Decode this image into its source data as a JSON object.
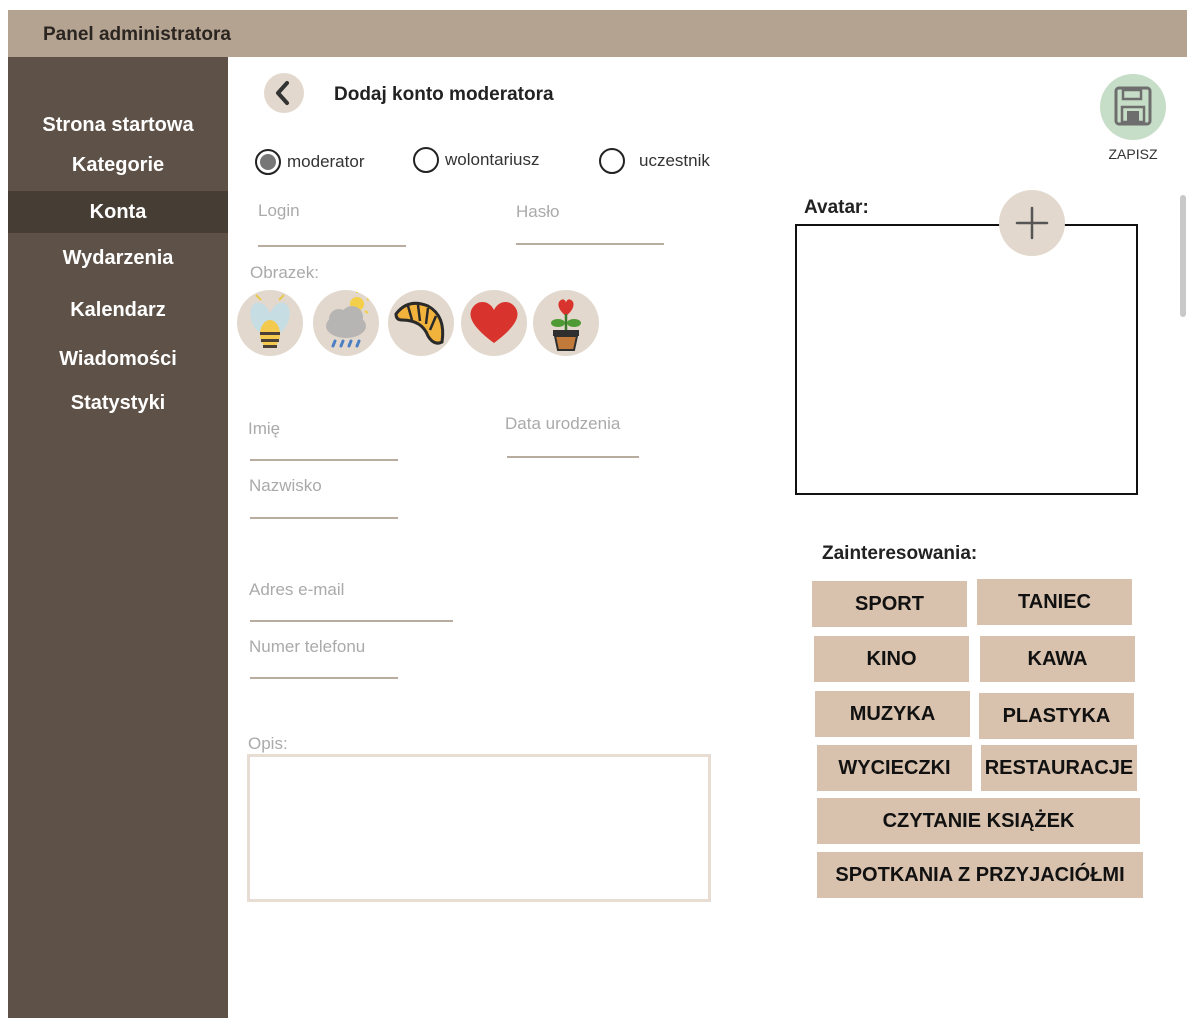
{
  "header": {
    "title": "Panel administratora"
  },
  "sidebar": {
    "items": [
      {
        "label": "Strona startowa"
      },
      {
        "label": "Kategorie"
      },
      {
        "label": "Konta",
        "active": true
      },
      {
        "label": "Wydarzenia"
      },
      {
        "label": "Kalendarz"
      },
      {
        "label": "Wiadomości"
      },
      {
        "label": "Statystyki"
      }
    ]
  },
  "page": {
    "title": "Dodaj konto moderatora",
    "back_icon": "chevron-left-icon"
  },
  "save": {
    "label": "ZAPISZ",
    "icon": "floppy-disk-icon"
  },
  "roles": [
    {
      "label": "moderator",
      "checked": true
    },
    {
      "label": "wolontariusz",
      "checked": false
    },
    {
      "label": "uczestnik",
      "checked": false
    }
  ],
  "form": {
    "login": "Login",
    "password": "Hasło",
    "image": "Obrazek:",
    "first_name": "Imię",
    "birth_date": "Data urodzenia",
    "last_name": "Nazwisko",
    "email": "Adres e-mail",
    "phone": "Numer telefonu",
    "description": "Opis:"
  },
  "image_options": [
    {
      "icon": "firefly-icon"
    },
    {
      "icon": "rain-cloud-icon"
    },
    {
      "icon": "croissant-icon"
    },
    {
      "icon": "heart-icon"
    },
    {
      "icon": "potted-heart-flower-icon"
    }
  ],
  "avatar": {
    "label": "Avatar:",
    "add_icon": "plus-icon"
  },
  "interests": {
    "label": "Zainteresowania:",
    "tags": [
      {
        "label": "SPORT"
      },
      {
        "label": "TANIEC"
      },
      {
        "label": "KINO"
      },
      {
        "label": "KAWA"
      },
      {
        "label": "MUZYKA"
      },
      {
        "label": "PLASTYKA"
      },
      {
        "label": "WYCIECZKI"
      },
      {
        "label": "RESTAURACJE"
      },
      {
        "label": "CZYTANIE KSIĄŻEK"
      },
      {
        "label": "SPOTKANIA Z PRZYJACIÓŁMI"
      }
    ]
  },
  "colors": {
    "topbar": "#b5a392",
    "sidebar": "#5e5248",
    "sidebar_active": "#463d35",
    "tag": "#d8c1ad",
    "icon_circle": "#e2d8cd",
    "save_circle": "#c6ddc7"
  }
}
